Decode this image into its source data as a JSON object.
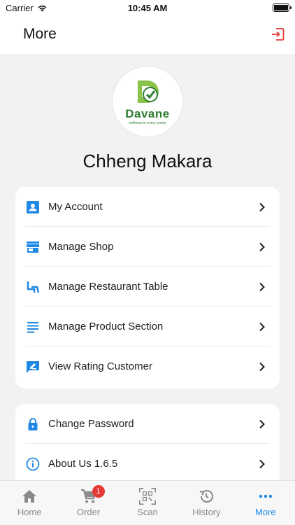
{
  "status_bar": {
    "carrier": "Carrier",
    "time": "10:45 AM"
  },
  "header": {
    "title": "More",
    "logout_icon": "logout-icon"
  },
  "profile": {
    "brand": "Davane",
    "tagline": "wellness in every scene",
    "name": "Chheng Makara"
  },
  "menu_group_1": [
    {
      "label": "My Account",
      "icon": "account-icon"
    },
    {
      "label": "Manage Shop",
      "icon": "shop-icon"
    },
    {
      "label": "Manage Restaurant Table",
      "icon": "table-chair-icon"
    },
    {
      "label": "Manage Product Section",
      "icon": "list-icon"
    },
    {
      "label": "View Rating Customer",
      "icon": "rating-icon"
    }
  ],
  "menu_group_2": [
    {
      "label": "Change Password",
      "icon": "lock-icon"
    },
    {
      "label": "About Us 1.6.5",
      "icon": "info-icon"
    }
  ],
  "tabs": [
    {
      "label": "Home",
      "icon": "home-icon"
    },
    {
      "label": "Order",
      "icon": "cart-icon",
      "badge": "1"
    },
    {
      "label": "Scan",
      "icon": "qr-scan-icon"
    },
    {
      "label": "History",
      "icon": "history-icon"
    },
    {
      "label": "More",
      "icon": "more-icon",
      "active": true
    }
  ],
  "colors": {
    "accent": "#1e88e5",
    "icon_blue": "#1e88e5",
    "logout_red": "#e53935",
    "badge_red": "#e53935",
    "brand_green": "#2e7d32"
  }
}
